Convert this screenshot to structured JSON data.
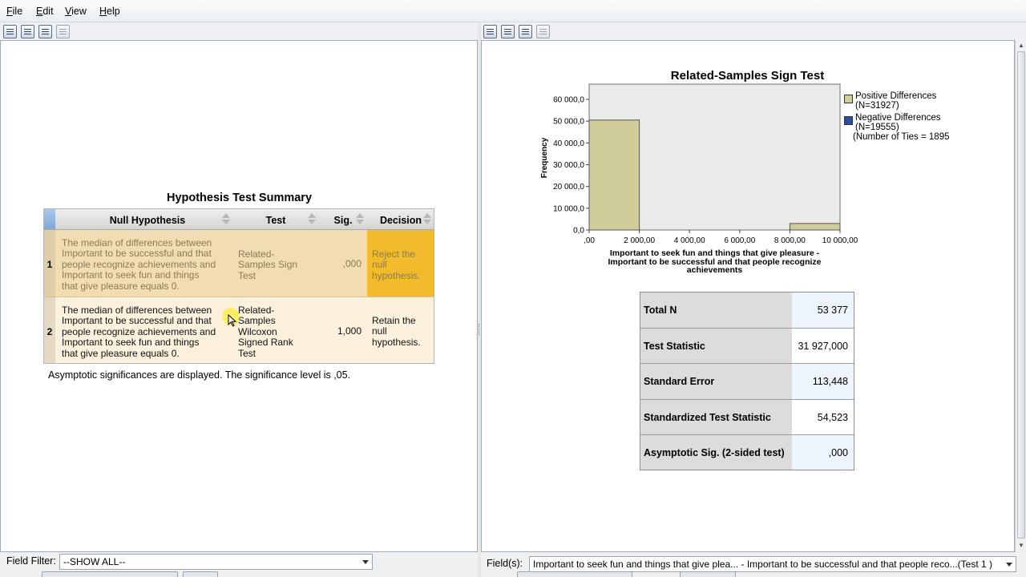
{
  "menubar": {
    "items": [
      {
        "mnemonic": "F",
        "rest": "ile"
      },
      {
        "mnemonic": "E",
        "rest": "dit"
      },
      {
        "mnemonic": "V",
        "rest": "iew"
      },
      {
        "mnemonic": "H",
        "rest": "elp"
      }
    ]
  },
  "toolbar_icons": [
    "copy-icon",
    "paste-icon",
    "print-icon",
    "pin-icon"
  ],
  "hypothesis_summary": {
    "title": "Hypothesis Test Summary",
    "headers": {
      "null_hypothesis": "Null Hypothesis",
      "test": "Test",
      "sig": "Sig.",
      "decision": "Decision"
    },
    "rows": [
      {
        "num": "1",
        "hypothesis": [
          "The median of differences between",
          "Important to be successful and that",
          "people recognize achievements and",
          "Important to seek fun and things",
          "that give pleasure equals 0."
        ],
        "test": [
          "Related-",
          "Samples Sign",
          "Test"
        ],
        "sig": ",000",
        "decision": [
          "Reject the",
          "null",
          "hypothesis."
        ]
      },
      {
        "num": "2",
        "hypothesis": [
          "The median of differences between",
          "Important to be successful and that",
          "people recognize achievements and",
          "Important to seek fun and things",
          "that give pleasure equals 0."
        ],
        "test": [
          "Related-",
          "Samples",
          "Wilcoxon",
          "Signed Rank",
          "Test"
        ],
        "sig": "1,000",
        "decision": [
          "Retain the",
          "null",
          "hypothesis."
        ]
      }
    ],
    "footnote": "Asymptotic significances are displayed.  The significance level is ,05."
  },
  "chart_data": {
    "type": "bar",
    "title": "Related-Samples Sign Test",
    "xlabel": [
      "Important to seek fun and things that give pleasure -",
      "Important to be successful and that people recognize",
      "achievements"
    ],
    "ylabel": "Frequency",
    "xlim": [
      0,
      10000
    ],
    "ylim": [
      0,
      60000
    ],
    "xticks": [
      ",00",
      "2 000,00",
      "4 000,00",
      "6 000,00",
      "8 000,00",
      "10 000,00"
    ],
    "yticks": [
      "0,0",
      "10 000,0",
      "20 000,0",
      "30 000,0",
      "40 000,0",
      "50 000,0",
      "60 000,0"
    ],
    "bins": [
      {
        "x0": 0,
        "x1": 2000,
        "value": 50500,
        "series": "positive"
      },
      {
        "x0": 8000,
        "x1": 10000,
        "value": 3000,
        "series": "positive"
      }
    ],
    "colors": {
      "positive": "#d1cd9a",
      "negative": "#2f4f9c",
      "plot_bg": "#ebebeb"
    },
    "legend": {
      "placement": "right",
      "entries": [
        {
          "label": "Positive Differences",
          "n": "(N=31927)",
          "color": "#d1cd9a"
        },
        {
          "label": "Negative Differences",
          "n": "(N=19555)",
          "color": "#2f4f9c"
        }
      ],
      "ties": "(Number of Ties = 1895"
    },
    "grid": false
  },
  "stats_table": {
    "rows": [
      {
        "label": "Total N",
        "value": "53 377"
      },
      {
        "label": "Test Statistic",
        "value": "31 927,000"
      },
      {
        "label": "Standard Error",
        "value": "113,448"
      },
      {
        "label": "Standardized Test Statistic",
        "value": "54,523"
      },
      {
        "label": "Asymptotic Sig. (2-sided test)",
        "value": ",000"
      }
    ]
  },
  "field_filter": {
    "label": "Field Filter:",
    "value": "--SHOW ALL--"
  },
  "fields": {
    "label": "Field(s):",
    "value": "Important to seek fun and things that give plea... - Important to be successful and that people reco...(Test 1 )"
  }
}
